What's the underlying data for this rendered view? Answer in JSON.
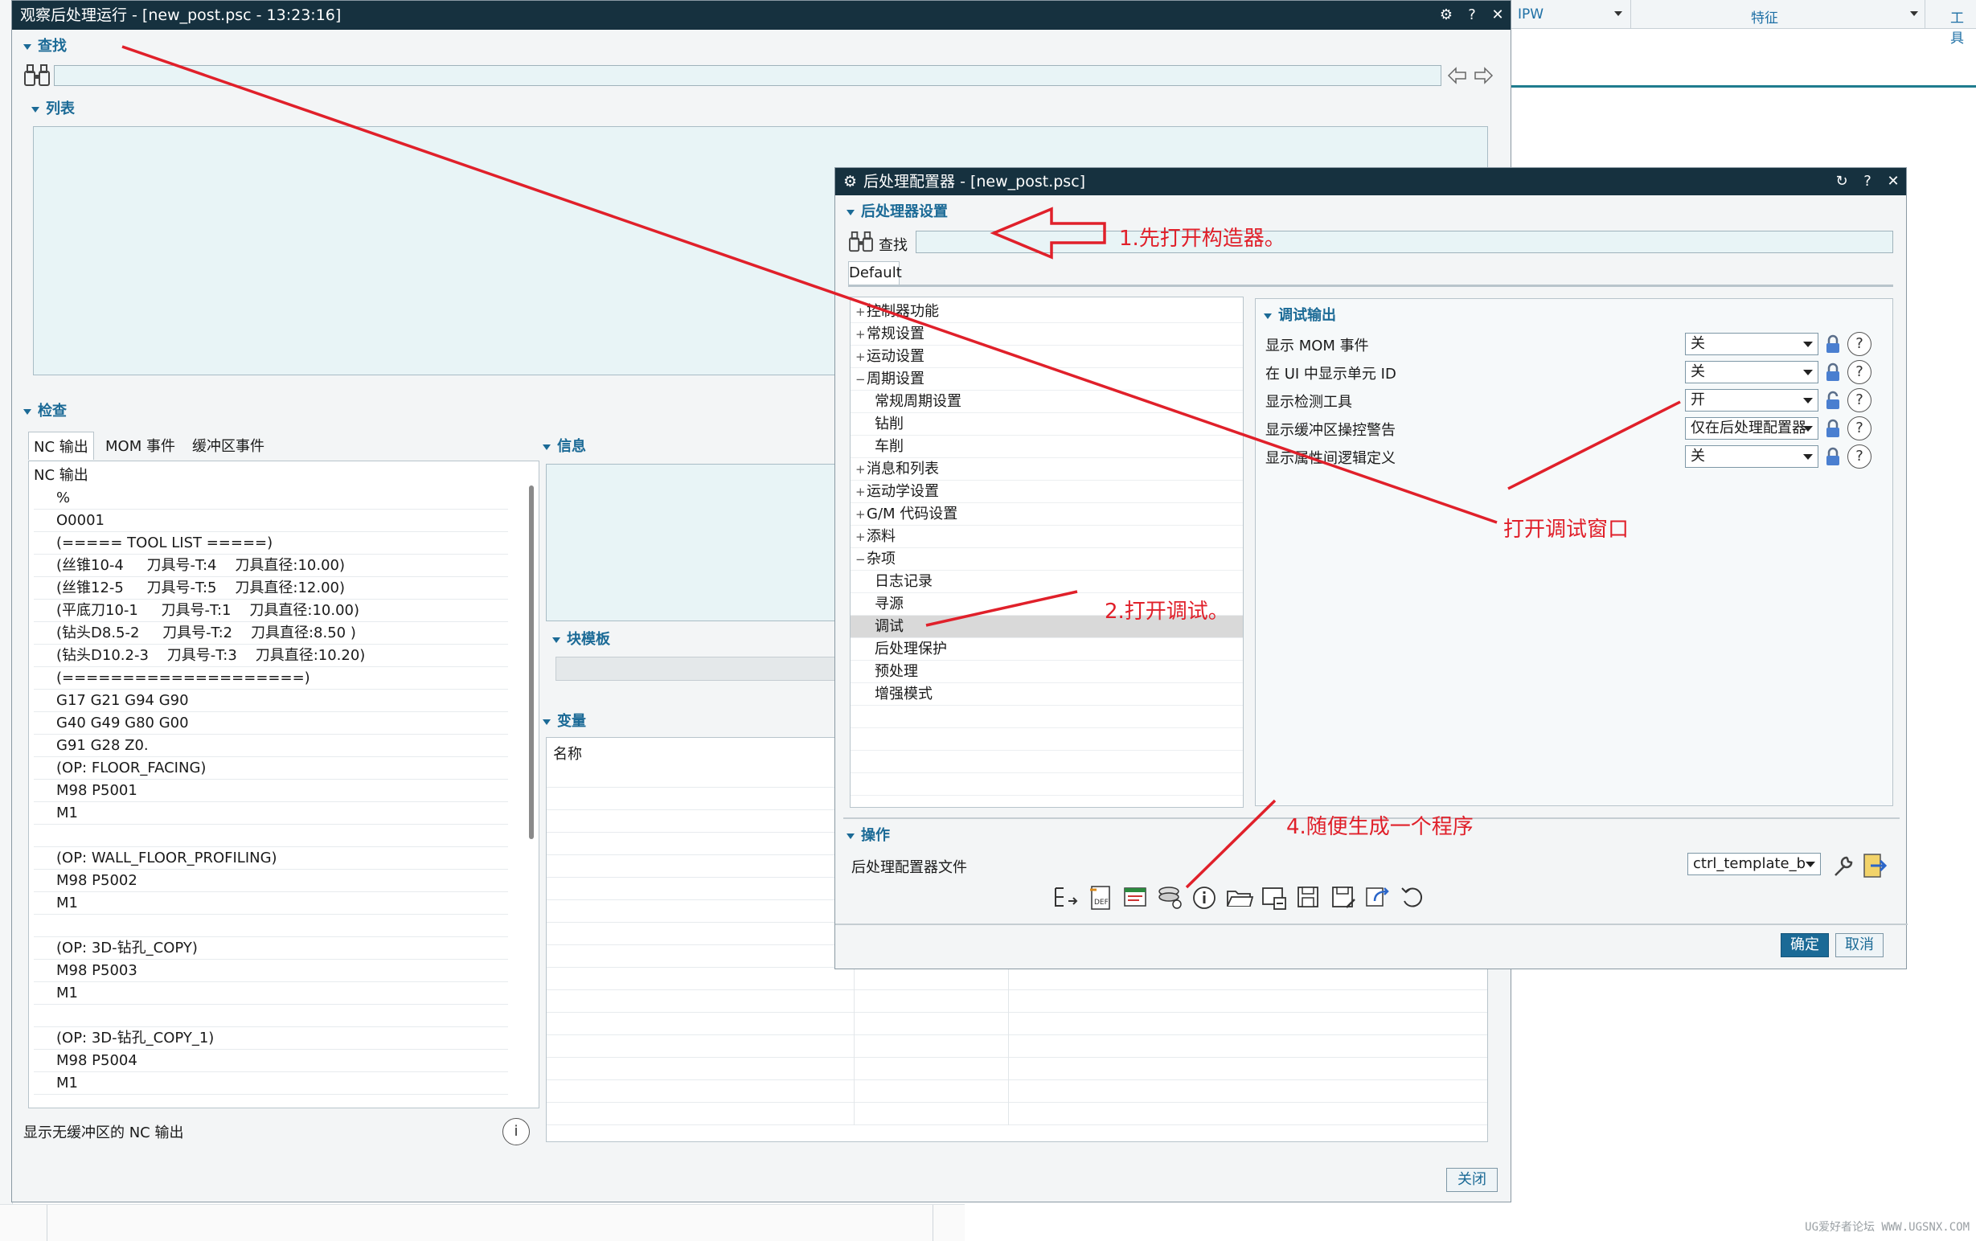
{
  "background": {
    "right_bar": {
      "ipw_label": "IPW",
      "feature_label": "特征",
      "tools_label": "工具"
    },
    "watermark": "UG爱好者论坛 WWW.UGSNX.COM"
  },
  "observer_window": {
    "title": "观察后处理运行 - [new_post.psc - 13:23:16]",
    "title_icons": {
      "gear": "⚙",
      "help": "?",
      "close": "✕"
    },
    "search_section": "查找",
    "list_section": "列表",
    "inspect_section": "检查",
    "tabs": [
      "NC 输出",
      "MOM 事件",
      "缓冲区事件"
    ],
    "nc_header": "NC 输出",
    "nc_lines": [
      "%",
      "O0001",
      "(===== TOOL LIST =====)",
      "(丝锥10-4     刀具号-T:4    刀具直径:10.00)",
      "(丝锥12-5     刀具号-T:5    刀具直径:12.00)",
      "(平底刀10-1     刀具号-T:1    刀具直径:10.00)",
      "(钻头D8.5-2     刀具号-T:2    刀具直径:8.50 )",
      "(钻头D10.2-3    刀具号-T:3    刀具直径:10.20)",
      "(====================)",
      "G17 G21 G94 G90",
      "G40 G49 G80 G00",
      "G91 G28 Z0.",
      "(OP: FLOOR_FACING)",
      "M98 P5001",
      "M1",
      "",
      "(OP: WALL_FLOOR_PROFILING)",
      "M98 P5002",
      "M1",
      "",
      "(OP: 3D-钻孔_COPY)",
      "M98 P5003",
      "M1",
      "",
      "(OP: 3D-钻孔_COPY_1)",
      "M98 P5004",
      "M1"
    ],
    "info_section": "信息",
    "block_template_section": "块模板",
    "variables_section": "变量",
    "var_column_name": "名称",
    "footer_text": "显示无缓冲区的 NC 输出",
    "close_button": "关闭"
  },
  "configurator_window": {
    "title": "后处理配置器 - [new_post.psc]",
    "title_icons": {
      "gear": "⚙",
      "refresh": "↻",
      "help": "?",
      "close": "✕"
    },
    "settings_section": "后处理器设置",
    "search_label": "查找",
    "default_tab": "Default",
    "tree": [
      {
        "label": "控制器功能",
        "sign": "+",
        "level": 0
      },
      {
        "label": "常规设置",
        "sign": "+",
        "level": 0
      },
      {
        "label": "运动设置",
        "sign": "+",
        "level": 0
      },
      {
        "label": "周期设置",
        "sign": "−",
        "level": 0
      },
      {
        "label": "常规周期设置",
        "sign": "",
        "level": 1
      },
      {
        "label": "钻削",
        "sign": "",
        "level": 1
      },
      {
        "label": "车削",
        "sign": "",
        "level": 1
      },
      {
        "label": "消息和列表",
        "sign": "+",
        "level": 0
      },
      {
        "label": "运动学设置",
        "sign": "+",
        "level": 0
      },
      {
        "label": "G/M 代码设置",
        "sign": "+",
        "level": 0
      },
      {
        "label": "添料",
        "sign": "+",
        "level": 0
      },
      {
        "label": "杂项",
        "sign": "−",
        "level": 0
      },
      {
        "label": "日志记录",
        "sign": "",
        "level": 1
      },
      {
        "label": "寻源",
        "sign": "",
        "level": 1
      },
      {
        "label": "调试",
        "sign": "",
        "level": 1,
        "selected": true
      },
      {
        "label": "后处理保护",
        "sign": "",
        "level": 1
      },
      {
        "label": "预处理",
        "sign": "",
        "level": 1
      },
      {
        "label": "增强模式",
        "sign": "",
        "level": 1
      }
    ],
    "debug_section": "调试输出",
    "debug_settings": [
      {
        "label": "显示 MOM 事件",
        "value": "关",
        "locked": true
      },
      {
        "label": "在 UI 中显示单元 ID",
        "value": "关",
        "locked": true
      },
      {
        "label": "显示检测工具",
        "value": "开",
        "locked": false
      },
      {
        "label": "显示缓冲区操控警告",
        "value": "仅在后处理配置器",
        "locked": true
      },
      {
        "label": "显示属性间逻辑定义",
        "value": "关",
        "locked": true
      }
    ],
    "operations_section": "操作",
    "config_file_label": "后处理配置器文件",
    "config_file_value": "ctrl_template_b",
    "ok_button": "确定",
    "cancel_button": "取消",
    "toolbar_icons": [
      "generate-program-icon",
      "def-file-icon",
      "report-icon",
      "settings-stack-icon",
      "info-icon",
      "open-folder-icon",
      "window-icon",
      "save-icon",
      "save-as-icon",
      "export-icon",
      "undo-icon"
    ]
  },
  "annotations": {
    "step1": "1.先打开构造器。",
    "step2": "2.打开调试。",
    "step3": "打开调试窗口",
    "step4": "4.随便生成一个程序",
    "color": "#e0202a"
  }
}
